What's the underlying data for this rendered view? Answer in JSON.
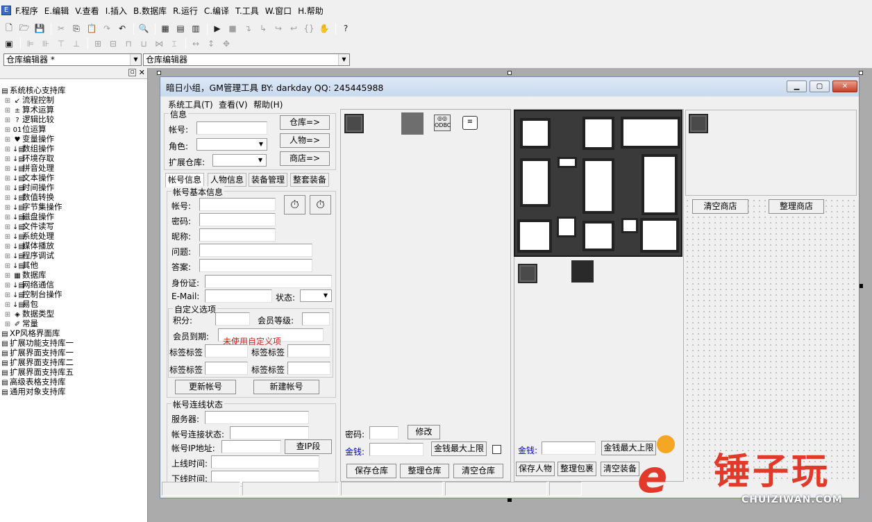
{
  "menubar": {
    "items": [
      "F.程序",
      "E.编辑",
      "V.查看",
      "I.插入",
      "B.数据库",
      "R.运行",
      "C.编译",
      "T.工具",
      "W.窗口",
      "H.帮助"
    ]
  },
  "toolbar": {
    "combo_left": "仓库编辑器 *",
    "combo_right": "仓库编辑器"
  },
  "sidebar": {
    "items": [
      {
        "label": "系统核心支持库",
        "level": 0,
        "icon": "library-icon"
      },
      {
        "label": "流程控制",
        "level": 1,
        "icon": "arrow-icon"
      },
      {
        "label": "算术运算",
        "level": 1,
        "icon": "math-icon"
      },
      {
        "label": "逻辑比较",
        "level": 1,
        "icon": "question-icon"
      },
      {
        "label": "位运算",
        "level": 1,
        "icon": "bits-icon"
      },
      {
        "label": "变量操作",
        "level": 1,
        "icon": "cup-icon"
      },
      {
        "label": "数组操作",
        "level": 1,
        "icon": "cmd-icon"
      },
      {
        "label": "环境存取",
        "level": 1,
        "icon": "cmd-icon"
      },
      {
        "label": "拼音处理",
        "level": 1,
        "icon": "cmd-icon"
      },
      {
        "label": "文本操作",
        "level": 1,
        "icon": "cmd-icon"
      },
      {
        "label": "时间操作",
        "level": 1,
        "icon": "cmd-icon"
      },
      {
        "label": "数值转换",
        "level": 1,
        "icon": "cmd-icon"
      },
      {
        "label": "字节集操作",
        "level": 1,
        "icon": "cmd-icon"
      },
      {
        "label": "磁盘操作",
        "level": 1,
        "icon": "cmd-icon"
      },
      {
        "label": "文件读写",
        "level": 1,
        "icon": "cmd-icon"
      },
      {
        "label": "系统处理",
        "level": 1,
        "icon": "cmd-icon"
      },
      {
        "label": "媒体播放",
        "level": 1,
        "icon": "cmd-icon"
      },
      {
        "label": "程序调试",
        "level": 1,
        "icon": "cmd-icon"
      },
      {
        "label": "其他",
        "level": 1,
        "icon": "cmd-icon"
      },
      {
        "label": "数据库",
        "level": 1,
        "icon": "table-icon"
      },
      {
        "label": "网络通信",
        "level": 1,
        "icon": "cmd-icon"
      },
      {
        "label": "控制台操作",
        "level": 1,
        "icon": "cmd-icon"
      },
      {
        "label": "易包",
        "level": 1,
        "icon": "cmd-icon"
      },
      {
        "label": "数据类型",
        "level": 1,
        "icon": "types-icon"
      },
      {
        "label": "常量",
        "level": 1,
        "icon": "const-icon"
      },
      {
        "label": "XP风格界面库",
        "level": 0,
        "icon": "library-icon"
      },
      {
        "label": "扩展功能支持库一",
        "level": 0,
        "icon": "library-icon"
      },
      {
        "label": "扩展界面支持库一",
        "level": 0,
        "icon": "library-icon"
      },
      {
        "label": "扩展界面支持库二",
        "level": 0,
        "icon": "library-icon"
      },
      {
        "label": "扩展界面支持库五",
        "level": 0,
        "icon": "library-icon"
      },
      {
        "label": "高级表格支持库",
        "level": 0,
        "icon": "library-icon"
      },
      {
        "label": "通用对象支持库",
        "level": 0,
        "icon": "library-icon"
      }
    ]
  },
  "window": {
    "title": "暗日小组，GM管理工具 BY: darkday QQ: 245445988",
    "menu": [
      "系统工具(T)",
      "查看(V)",
      "帮助(H)"
    ]
  },
  "info": {
    "caption": "信息",
    "account_label": "帐号:",
    "role_label": "角色:",
    "ext_label": "扩展仓库:",
    "btn_warehouse": "仓库=>",
    "btn_character": "人物=>",
    "btn_shop": "商店=>"
  },
  "tabs": [
    "帐号信息",
    "人物信息",
    "装备管理",
    "整套装备"
  ],
  "account": {
    "caption": "帐号基本信息",
    "account": "帐号:",
    "password": "密码:",
    "nickname": "昵称:",
    "question": "问题:",
    "answer": "答案:",
    "idcard": "身份证:",
    "email": "E-Mail:",
    "status": "状态:"
  },
  "custom": {
    "caption": "自定义选项",
    "points": "积分:",
    "level": "会员等级:",
    "expire": "会员到期:",
    "unused": "未使用自定义项",
    "tag1": "标签标签",
    "tag2": "标签标签",
    "tag3": "标签标签",
    "tag4": "标签标签"
  },
  "actions": {
    "update": "更新帐号",
    "create": "新建帐号"
  },
  "conn": {
    "caption": "帐号连线状态",
    "server": "服务器:",
    "state": "帐号连接状态:",
    "ip": "帐号IP地址:",
    "check_ip": "查IP段",
    "online": "上线时间:",
    "offline": "下线时间:"
  },
  "warehouse": {
    "password": "密码:",
    "modify": "修改",
    "gold": "金钱:",
    "gold_max": "金钱最大上限",
    "save": "保存仓库",
    "sort": "整理仓库",
    "clear": "清空仓库"
  },
  "character": {
    "gold": "金钱:",
    "gold_max": "金钱最大上限",
    "save": "保存人物",
    "sort_bag": "整理包裹",
    "clear_equip": "清空装备"
  },
  "shop": {
    "clear": "清空商店",
    "sort": "整理商店"
  },
  "watermark": {
    "text": "锤子玩",
    "url": "CHUIZIWAN.COM"
  },
  "colors": {
    "accent_red": "#d42020",
    "gold_blue": "#0000c8",
    "watermark_orange": "#f5a623"
  }
}
